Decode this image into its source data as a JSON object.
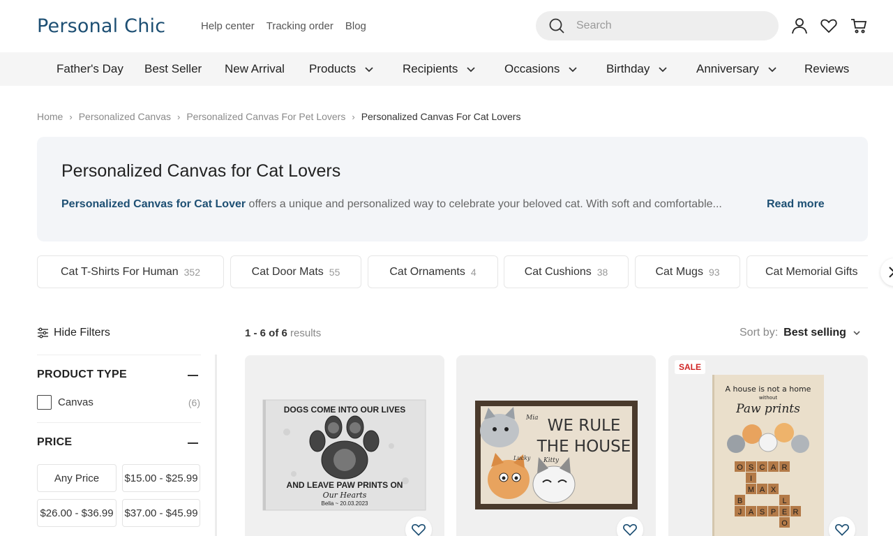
{
  "header": {
    "logo": "Personal Chic",
    "links": [
      "Help center",
      "Tracking order",
      "Blog"
    ],
    "search_placeholder": "Search"
  },
  "nav": {
    "items": [
      {
        "label": "Father's Day",
        "has_dropdown": false
      },
      {
        "label": "Best Seller",
        "has_dropdown": false
      },
      {
        "label": "New Arrival",
        "has_dropdown": false
      },
      {
        "label": "Products",
        "has_dropdown": true
      },
      {
        "label": "Recipients",
        "has_dropdown": true
      },
      {
        "label": "Occasions",
        "has_dropdown": true
      },
      {
        "label": "Birthday",
        "has_dropdown": true
      },
      {
        "label": "Anniversary",
        "has_dropdown": true
      },
      {
        "label": "Reviews",
        "has_dropdown": false
      }
    ]
  },
  "breadcrumb": [
    "Home",
    "Personalized Canvas",
    "Personalized Canvas For Pet Lovers",
    "Personalized Canvas For Cat Lovers"
  ],
  "intro": {
    "title": "Personalized Canvas for Cat Lovers",
    "lead": "Personalized Canvas for Cat Lover",
    "text": " offers a unique and personalized way to celebrate your beloved cat. With soft and comfortable...",
    "read_more": "Read more"
  },
  "chips": [
    {
      "label": "Cat T-Shirts For Human",
      "count": "352"
    },
    {
      "label": "Cat Door Mats",
      "count": "55"
    },
    {
      "label": "Cat Ornaments",
      "count": "4"
    },
    {
      "label": "Cat Cushions",
      "count": "38"
    },
    {
      "label": "Cat Mugs",
      "count": "93"
    },
    {
      "label": "Cat Memorial Gifts",
      "count": ""
    }
  ],
  "filters": {
    "hide_label": "Hide Filters",
    "product_type": {
      "title": "PRODUCT TYPE",
      "options": [
        {
          "label": "Canvas",
          "count": "(6)"
        }
      ]
    },
    "price": {
      "title": "PRICE",
      "options": [
        "Any Price",
        "$15.00 - $25.99",
        "$26.00 - $36.99",
        "$37.00 - $45.99"
      ]
    }
  },
  "results": {
    "range": "1 - 6 of 6",
    "suffix": " results"
  },
  "sort": {
    "label": "Sort by:",
    "value": "Best selling"
  },
  "products": [
    {
      "badge": "",
      "art_lines": [
        "DOGS COME INTO OUR LIVES",
        "AND LEAVE PAW PRINTS ON",
        "Our Hearts",
        "Bella ~ 20.03.2023"
      ]
    },
    {
      "badge": "",
      "art_lines": [
        "WE RULE",
        "THE HOUSE",
        "Mia",
        "Lucky",
        "Kitty"
      ]
    },
    {
      "badge": "SALE",
      "art_lines": [
        "A house is not a home",
        "without",
        "Paw prints"
      ],
      "tiles": [
        [
          "O",
          "S",
          "C",
          "A",
          "R"
        ],
        [
          "I"
        ],
        [
          "M",
          "A",
          "X"
        ],
        [
          "B",
          "L"
        ],
        [
          "J",
          "A",
          "S",
          "P",
          "E",
          "R"
        ],
        [
          "O"
        ]
      ]
    }
  ],
  "colors": {
    "brand": "#1d4f73",
    "sale": "#d02525",
    "nav_bg": "#f5f5f5",
    "intro_bg": "#f3f5f8"
  }
}
